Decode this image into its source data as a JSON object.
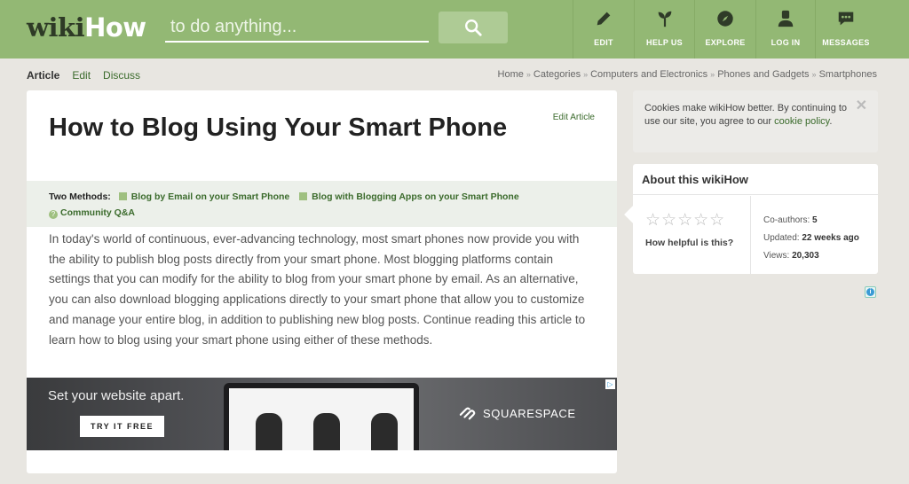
{
  "header": {
    "logo_wiki": "wiki",
    "logo_how": "How",
    "search_placeholder": "to do anything...",
    "nav": [
      {
        "label": "EDIT",
        "icon": "pencil-icon"
      },
      {
        "label": "HELP US",
        "icon": "sprout-icon"
      },
      {
        "label": "EXPLORE",
        "icon": "compass-icon"
      },
      {
        "label": "LOG IN",
        "icon": "user-icon"
      },
      {
        "label": "MESSAGES",
        "icon": "chat-icon"
      }
    ]
  },
  "tabs": {
    "article": "Article",
    "edit": "Edit",
    "discuss": "Discuss"
  },
  "breadcrumb": [
    "Home",
    "Categories",
    "Computers and Electronics",
    "Phones and Gadgets",
    "Smartphones"
  ],
  "article": {
    "edit_link": "Edit Article",
    "title": "How to Blog Using Your Smart Phone",
    "methods_label": "Two Methods:",
    "method_1": "Blog by Email on your Smart Phone",
    "method_2": "Blog with Blogging Apps on your Smart Phone",
    "community": "Community Q&A",
    "intro": "In today's world of continuous, ever-advancing technology, most smart phones now provide you with the ability to publish blog posts directly from your smart phone. Most blogging platforms contain settings that you can modify for the ability to blog from your smart phone by email. As an alternative, you can also download blogging applications directly to your smart phone that allow you to customize and manage your entire blog, in addition to publishing new blog posts. Continue reading this article to learn how to blog using your smart phone using either of these methods."
  },
  "ad": {
    "headline": "Set your website apart.",
    "cta": "TRY IT FREE",
    "brand": "SQUARESPACE"
  },
  "cookie": {
    "text": "Cookies make wikiHow better. By continuing to use our site, you agree to our ",
    "link": "cookie policy",
    "end": "."
  },
  "about": {
    "title": "About this wikiHow",
    "stars": "☆☆☆☆☆",
    "helpful": "How helpful is this?",
    "coauthors_label": "Co-authors:",
    "coauthors": "5",
    "updated_label": "Updated:",
    "updated": "22 weeks ago",
    "views_label": "Views:",
    "views": "20,303"
  },
  "colors": {
    "header_green": "#93b874",
    "link_green": "#3b6b2c"
  }
}
